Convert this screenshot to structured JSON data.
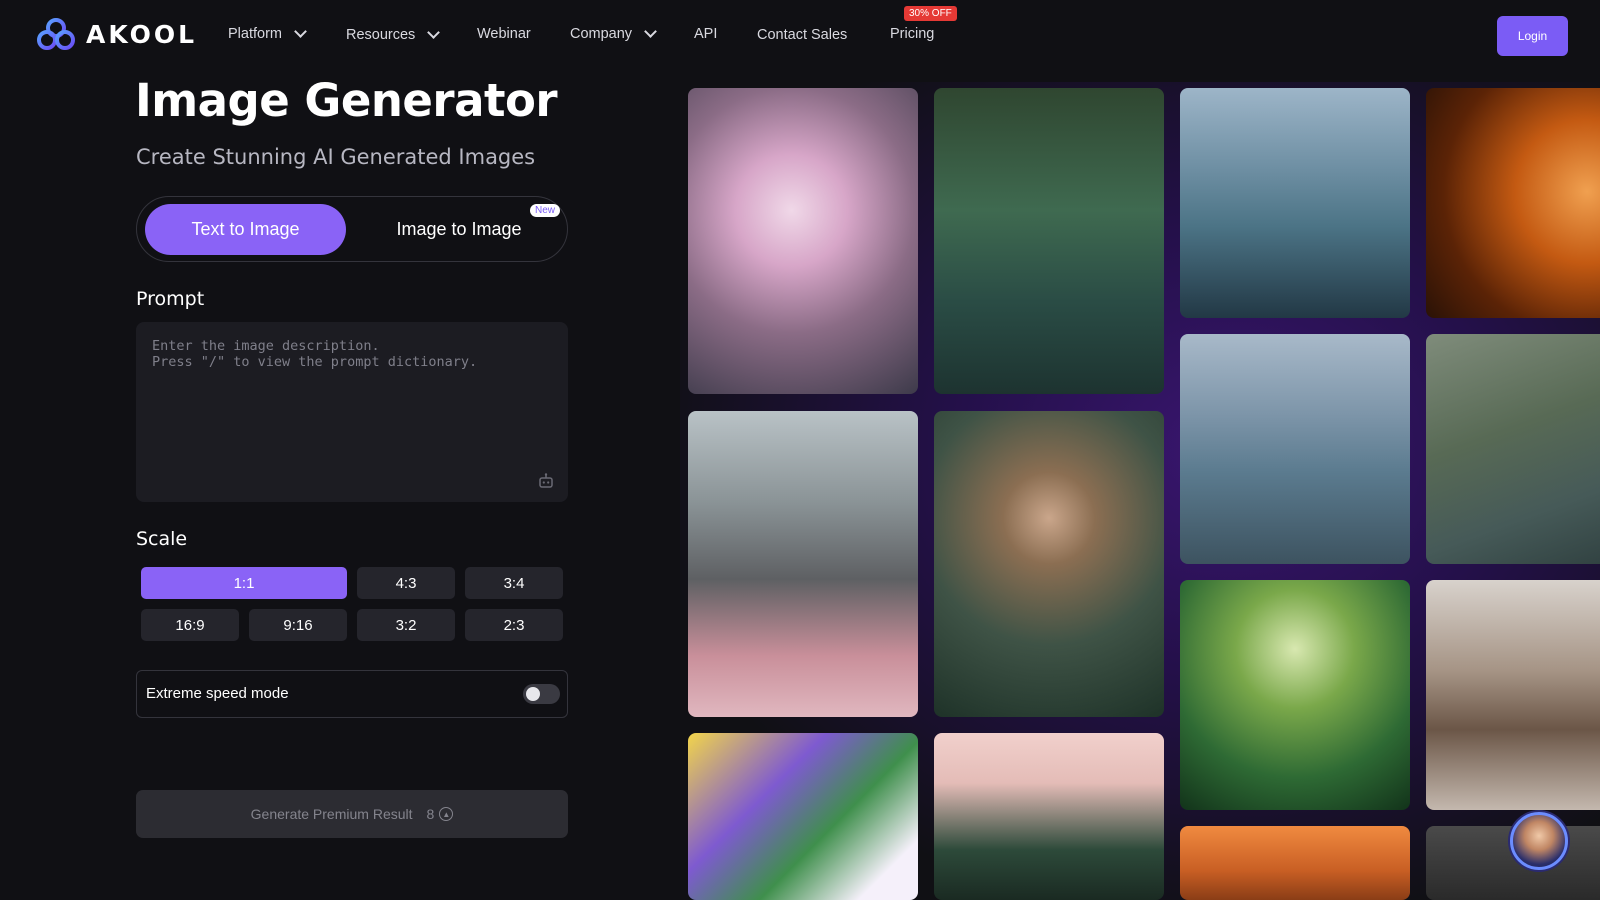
{
  "nav": {
    "brand": "AKOOL",
    "items": [
      {
        "label": "Platform",
        "has_dropdown": true
      },
      {
        "label": "Resources",
        "has_dropdown": true
      },
      {
        "label": "Webinar",
        "has_dropdown": false
      },
      {
        "label": "Company",
        "has_dropdown": true
      },
      {
        "label": "API",
        "has_dropdown": false
      },
      {
        "label": "Contact Sales",
        "has_dropdown": false
      },
      {
        "label": "Pricing",
        "has_dropdown": false
      }
    ],
    "pricing_badge": "30% OFF",
    "login_label": "Login"
  },
  "hero": {
    "title": "Image Generator",
    "subtitle": "Create Stunning AI Generated Images"
  },
  "mode": {
    "text_to_image": "Text to Image",
    "image_to_image": "Image to Image",
    "new_badge": "New",
    "selected": "Text to Image"
  },
  "prompt": {
    "label": "Prompt",
    "placeholder": "Enter the image description.\nPress \"/\" to view the prompt dictionary.",
    "icon": "robot-icon"
  },
  "scale": {
    "label": "Scale",
    "options": [
      "1:1",
      "4:3",
      "3:4",
      "16:9",
      "9:16",
      "3:2",
      "2:3"
    ],
    "selected": "1:1"
  },
  "speed_mode": {
    "label": "Extreme speed mode",
    "enabled": false
  },
  "generate": {
    "label": "Generate Premium Result",
    "cost": "8",
    "icon": "credit-coin-icon"
  },
  "gallery": {
    "tiles": [
      {
        "name": "glowing-flowers"
      },
      {
        "name": "woman-in-water"
      },
      {
        "name": "perfume-lake"
      },
      {
        "name": "girl-fire-portrait"
      },
      {
        "name": "flower-conservatory"
      },
      {
        "name": "woman-green-dress"
      },
      {
        "name": "perfume-mountain-lake"
      },
      {
        "name": "canyon-river-boat"
      },
      {
        "name": "iris-illustration"
      },
      {
        "name": "cat-plant"
      },
      {
        "name": "jungle-waterfall"
      },
      {
        "name": "modern-bedroom"
      },
      {
        "name": "orange-drink"
      },
      {
        "name": "dark-cat"
      }
    ]
  },
  "colors": {
    "accent": "#8a63f6",
    "background": "#101014",
    "badge_red": "#e53935"
  }
}
